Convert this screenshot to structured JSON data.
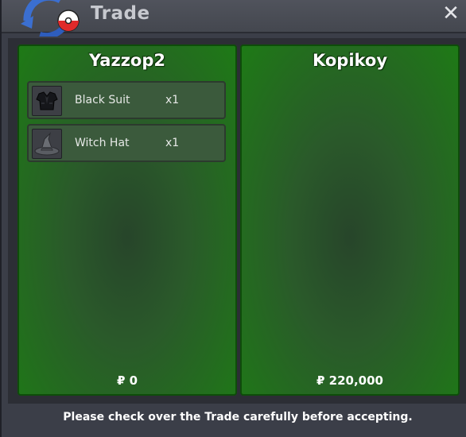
{
  "window": {
    "title": "Trade",
    "close_label": "✕"
  },
  "left_panel": {
    "name": "Yazzop2",
    "items": [
      {
        "name": "Black Suit",
        "qty": "x1",
        "icon": "black-suit-icon"
      },
      {
        "name": "Witch Hat",
        "qty": "x1",
        "icon": "witch-hat-icon"
      }
    ],
    "money": "₽ 0"
  },
  "right_panel": {
    "name": "Kopikoy",
    "items": [],
    "money": "₽ 220,000"
  },
  "footer": {
    "notice": "Please check over the Trade carefully before accepting."
  },
  "colors": {
    "panel_green": "#1e7a16",
    "panel_dark": "#27452a",
    "window_bg": "#3b3e48"
  }
}
